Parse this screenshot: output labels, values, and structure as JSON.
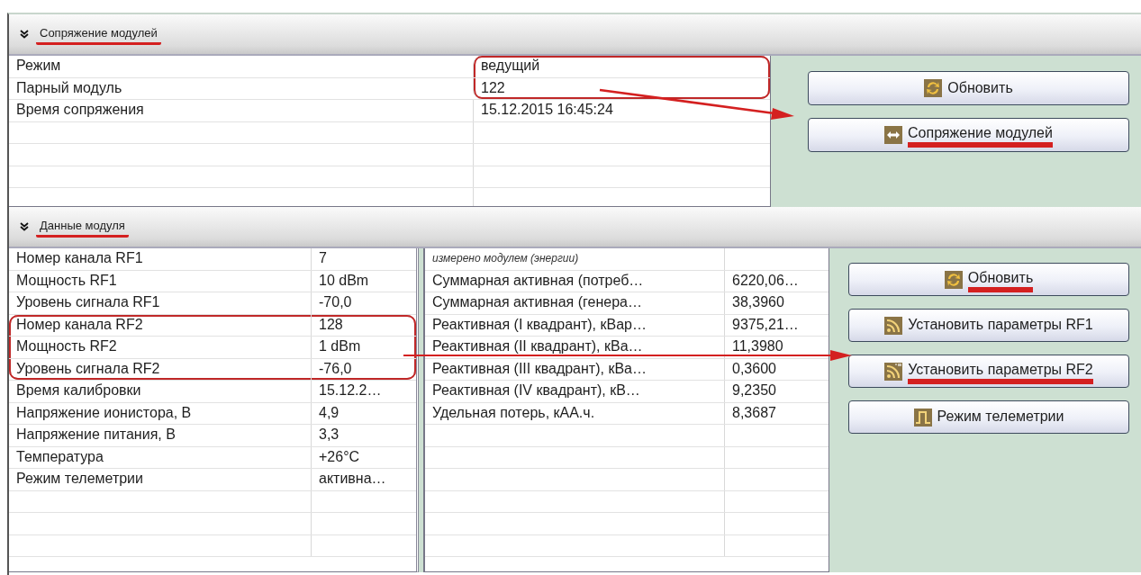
{
  "sections": [
    {
      "title": "Сопряжение модулей",
      "expanded": true,
      "underlined": true,
      "tables": [
        {
          "rows": [
            {
              "label": "Режим",
              "value": "ведущий",
              "circled": true
            },
            {
              "label": "Парный модуль",
              "value": "122",
              "circled": true
            },
            {
              "label": "Время сопряжения",
              "value": "15.12.2015 16:45:24",
              "circled": false
            }
          ]
        }
      ],
      "buttons": [
        {
          "label": "Обновить",
          "underlined": false
        },
        {
          "label": "Сопряжение модулей",
          "underlined": true
        }
      ]
    },
    {
      "title": "Данные модуля",
      "expanded": true,
      "underlined": true,
      "tables": [
        {
          "rows": [
            {
              "label": "Номер канала RF1",
              "value": "7",
              "circled": false
            },
            {
              "label": "Мощность RF1",
              "value": "10 dBm",
              "circled": false
            },
            {
              "label": "Уровень сигнала RF1",
              "value": "-70,0",
              "circled": false
            },
            {
              "label": "Номер канала RF2",
              "value": "128",
              "circled": true
            },
            {
              "label": "Мощность RF2",
              "value": "1 dBm",
              "circled": true
            },
            {
              "label": "Уровень сигнала RF2",
              "value": "-76,0",
              "circled": true
            },
            {
              "label": "Время калибровки",
              "value": "15.12.2…",
              "circled": false
            },
            {
              "label": "Напряжение ионистора, В",
              "value": "4,9",
              "circled": false
            },
            {
              "label": "Напряжение питания, В",
              "value": "3,3",
              "circled": false
            },
            {
              "label": "Температура",
              "value": "+26°C",
              "circled": false
            },
            {
              "label": "Режим телеметрии",
              "value": "активна…",
              "circled": false
            }
          ]
        },
        {
          "rows": [
            {
              "kind": "caption",
              "label": "измерено модулем (энергии)"
            },
            {
              "kind": "data",
              "label": "Суммарная активная (потреб…",
              "value": "6220,06…",
              "circled": false
            },
            {
              "kind": "data",
              "label": "Суммарная активная (генера…",
              "value": "38,3960",
              "circled": false
            },
            {
              "kind": "data",
              "label": "Реактивная (I квадрант), кВар…",
              "value": "9375,21…",
              "circled": false
            },
            {
              "kind": "data",
              "label": "Реактивная (II квадрант), кВа…",
              "value": "11,3980",
              "circled": false
            },
            {
              "kind": "data",
              "label": "Реактивная (III квадрант), кВа…",
              "value": "0,3600",
              "circled": false
            },
            {
              "kind": "data",
              "label": "Реактивная (IV квадрант), кВ…",
              "value": "9,2350",
              "circled": false
            },
            {
              "kind": "data",
              "label": "Удельная потерь, кАА.ч.",
              "value": "8,3687",
              "circled": false
            }
          ]
        }
      ],
      "buttons": [
        {
          "label": "Обновить",
          "underlined": true
        },
        {
          "label": "Установить параметры RF1",
          "underlined": false
        },
        {
          "label": "Установить параметры RF2",
          "underlined": true
        },
        {
          "label": "Режим телеметрии",
          "underlined": false
        }
      ]
    }
  ]
}
